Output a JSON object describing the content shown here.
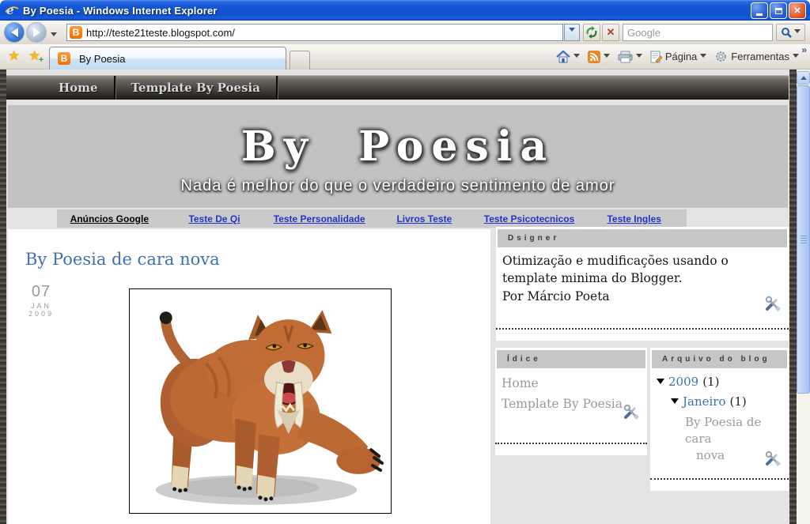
{
  "titlebar": {
    "title": "By Poesia - Windows Internet Explorer"
  },
  "address": {
    "url": "http://teste21teste.blogspot.com/",
    "search_placeholder": "Google"
  },
  "tabs": {
    "active": "By Poesia"
  },
  "commandbar": {
    "page_label": "Página",
    "tools_label": "Ferramentas"
  },
  "icons": {
    "star": "★",
    "plus": "+",
    "close": "✕",
    "stop": "✕",
    "overflow": "»",
    "blogger_b": "B"
  },
  "site": {
    "nav": {
      "home": "Home",
      "template": "Template By Poesia"
    },
    "header": {
      "title": "By Poesia",
      "tagline": "Nada é melhor do que o verdadeiro sentimento de amor"
    },
    "adbar": {
      "label": "Anúncios Google",
      "links": [
        "Teste De Qi",
        "Teste Personalidade",
        "Livros Teste",
        "Teste Psicotecnicos",
        "Teste Ingles"
      ]
    },
    "post": {
      "title": "By Poesia de cara nova",
      "day": "07",
      "month": "JAN",
      "year": "2009"
    },
    "dsigner": {
      "title": "Dsigner",
      "body": "Otimização e mudificações usando o template minima do Blogger.",
      "author": "Por Márcio Poeta"
    },
    "indice": {
      "title": "Ídice",
      "items": [
        "Home",
        "Template By Poesia"
      ]
    },
    "arquivo": {
      "title": "Arquivo do blog",
      "year": "2009",
      "year_count": "(1)",
      "month": "Janeiro",
      "month_count": "(1)",
      "post_line1": "By Poesia de cara",
      "post_line2": "nova"
    }
  },
  "colors": {
    "xp_blue": "#1657d6",
    "link_blue": "#2432cc",
    "post_blue": "#3f71ad",
    "header_gray": "#c2c2c2"
  }
}
